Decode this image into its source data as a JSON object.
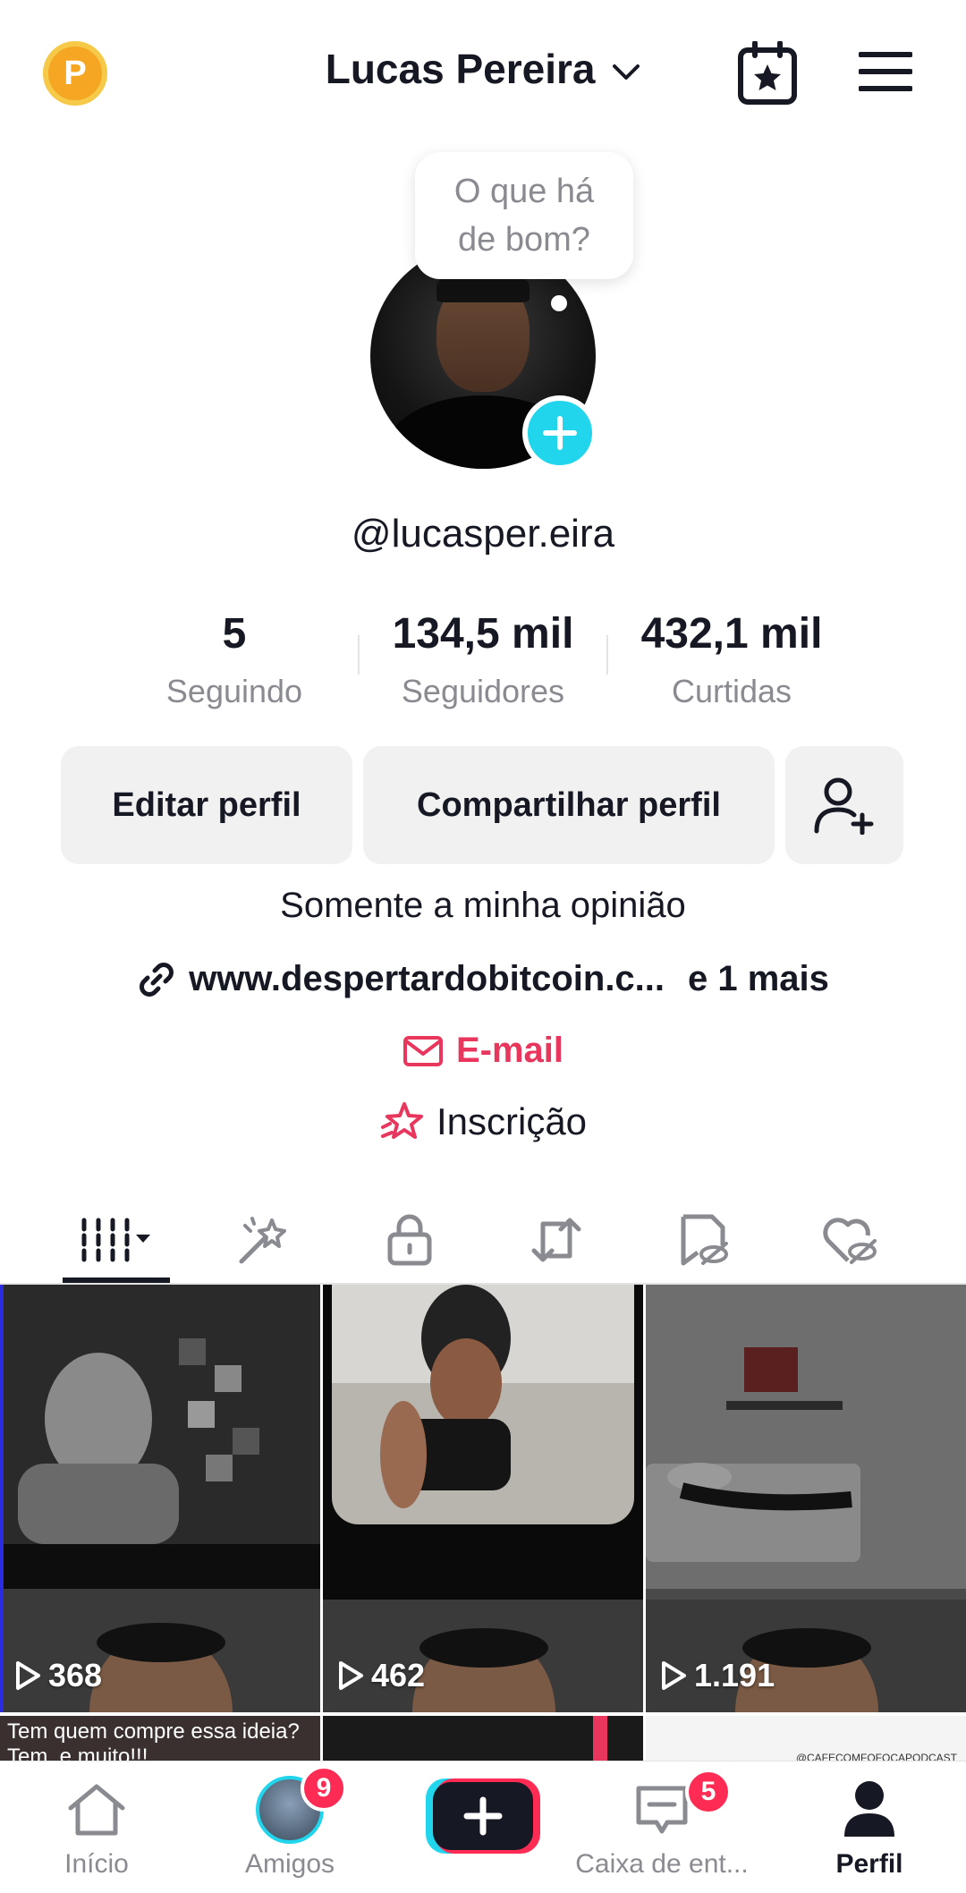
{
  "header": {
    "title": "Lucas Pereira",
    "coin_label": "P"
  },
  "profile": {
    "bubble_text": "O que há de bom?",
    "username": "@lucasper.eira",
    "stats": [
      {
        "value": "5",
        "label": "Seguindo"
      },
      {
        "value": "134,5 mil",
        "label": "Seguidores"
      },
      {
        "value": "432,1 mil",
        "label": "Curtidas"
      }
    ],
    "buttons": {
      "edit": "Editar perfil",
      "share": "Compartilhar perfil"
    },
    "bio": "Somente a minha opinião",
    "link": "www.despertardobitcoin.c...",
    "link_more": "e 1 mais",
    "email": "E-mail",
    "subscription": "Inscrição"
  },
  "tabs": [
    "videos-icon",
    "magic-icon",
    "lock-icon",
    "repost-icon",
    "saved-icon",
    "liked-icon"
  ],
  "videos": [
    {
      "views": "368",
      "caption": ""
    },
    {
      "views": "462",
      "caption": ""
    },
    {
      "views": "1.191",
      "caption": ""
    }
  ],
  "second_row": {
    "caption_1": "Tem quem compre essa ideia? Tem, e muito!!!",
    "watermark_3": "@CAFECOMFOFOCAPODCAST"
  },
  "bottom_nav": {
    "home": "Início",
    "friends": "Amigos",
    "friends_badge": "9",
    "inbox": "Caixa de ent...",
    "inbox_badge": "5",
    "profile": "Perfil"
  },
  "colors": {
    "accent": "#fe2c55",
    "cyan": "#20d5ec",
    "email": "#e8365d"
  }
}
